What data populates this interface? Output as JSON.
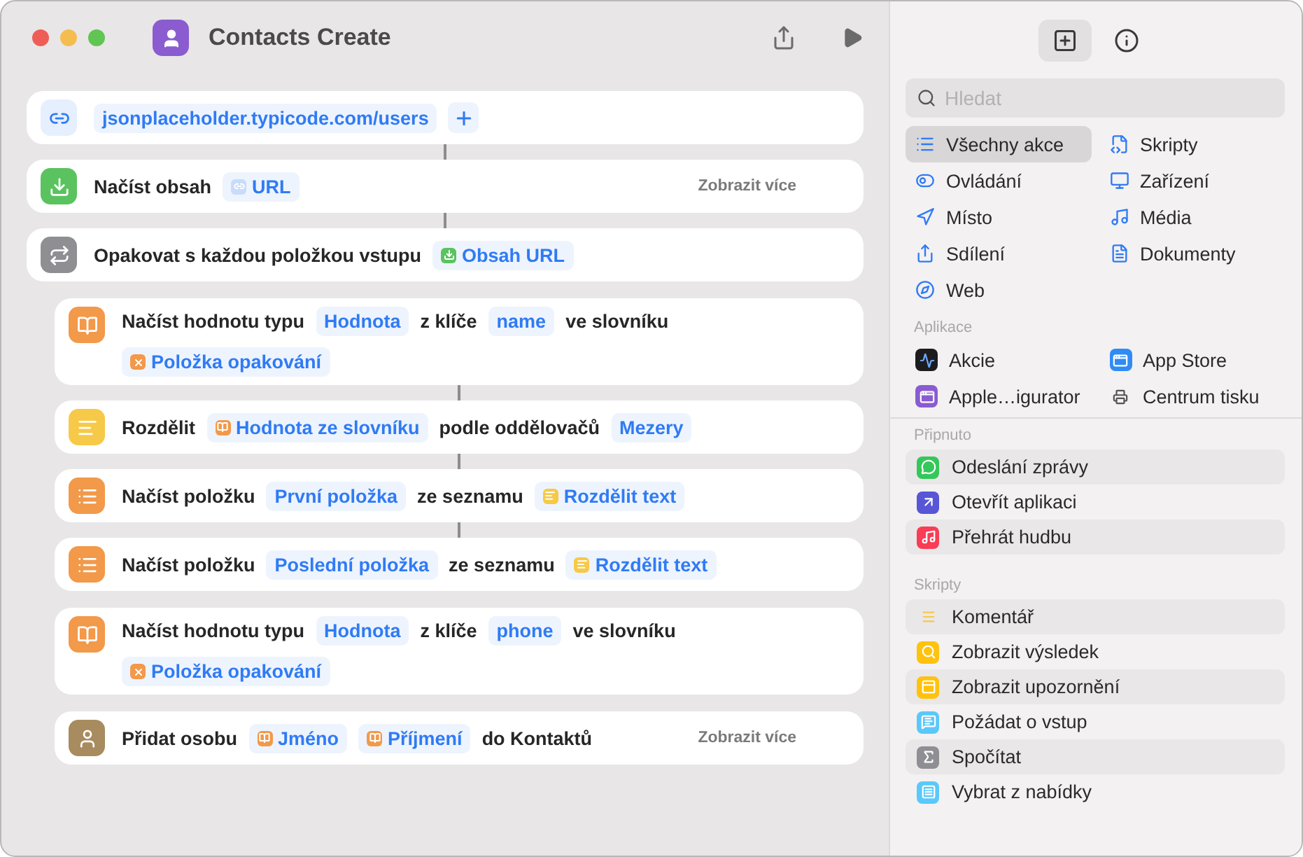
{
  "window": {
    "title": "Contacts Create"
  },
  "actions": [
    {
      "kind": "link",
      "connected_to_next": true,
      "parts": [
        {
          "kind": "token",
          "text": "jsonplaceholder.typicode.com/users"
        },
        {
          "kind": "add"
        }
      ]
    },
    {
      "kind": "download",
      "connected_to_next": true,
      "show_more": "Zobrazit více",
      "parts": [
        {
          "kind": "text",
          "text": "Načíst obsah"
        },
        {
          "kind": "link-token",
          "text": "URL"
        }
      ]
    },
    {
      "kind": "repeat",
      "connected_to_next": false,
      "parts": [
        {
          "kind": "text",
          "text": "Opakovat s každou položkou vstupu"
        },
        {
          "kind": "download-token",
          "text": "Obsah URL"
        }
      ],
      "children": [
        {
          "kind": "dictionary",
          "connected_to_next": true,
          "parts": [
            {
              "kind": "text",
              "text": "Načíst hodnotu typu"
            },
            {
              "kind": "token",
              "text": "Hodnota"
            },
            {
              "kind": "text",
              "text": "z klíče"
            },
            {
              "kind": "token",
              "text": "name"
            },
            {
              "kind": "text",
              "text": "ve slovníku"
            },
            {
              "kind": "break"
            },
            {
              "kind": "variable-token",
              "text": "Položka opakování"
            }
          ]
        },
        {
          "kind": "text",
          "connected_to_next": true,
          "parts": [
            {
              "kind": "text",
              "text": "Rozdělit"
            },
            {
              "kind": "dictionary-token",
              "text": "Hodnota ze slovníku"
            },
            {
              "kind": "text",
              "text": "podle oddělovačů"
            },
            {
              "kind": "token",
              "text": "Mezery"
            }
          ]
        },
        {
          "kind": "list",
          "connected_to_next": true,
          "parts": [
            {
              "kind": "text",
              "text": "Načíst položku"
            },
            {
              "kind": "token",
              "text": "První položka"
            },
            {
              "kind": "text",
              "text": "ze seznamu"
            },
            {
              "kind": "text-token",
              "text": "Rozdělit text"
            }
          ]
        },
        {
          "kind": "list",
          "connected_to_next": false,
          "parts": [
            {
              "kind": "text",
              "text": "Načíst položku"
            },
            {
              "kind": "token",
              "text": "Poslední položka"
            },
            {
              "kind": "text",
              "text": "ze seznamu"
            },
            {
              "kind": "text-token",
              "text": "Rozdělit text"
            }
          ]
        },
        {
          "kind": "dictionary",
          "connected_to_next": false,
          "parts": [
            {
              "kind": "text",
              "text": "Načíst hodnotu typu"
            },
            {
              "kind": "token",
              "text": "Hodnota"
            },
            {
              "kind": "text",
              "text": "z klíče"
            },
            {
              "kind": "token",
              "text": "phone"
            },
            {
              "kind": "text",
              "text": "ve slovníku"
            },
            {
              "kind": "break"
            },
            {
              "kind": "variable-token",
              "text": "Položka opakování"
            }
          ]
        },
        {
          "kind": "contact",
          "connected_to_next": false,
          "show_more": "Zobrazit více",
          "parts": [
            {
              "kind": "text",
              "text": "Přidat osobu"
            },
            {
              "kind": "dictionary-token",
              "text": "Jméno"
            },
            {
              "kind": "dictionary-token",
              "text": "Příjmení"
            },
            {
              "kind": "text",
              "text": "do Kontaktů"
            }
          ]
        }
      ]
    }
  ],
  "library": {
    "tabs": [
      {
        "kind": "add",
        "selected": true
      },
      {
        "kind": "info",
        "selected": false
      }
    ],
    "search": {
      "placeholder": "Hledat"
    },
    "categories": [
      {
        "label": "Všechny akce",
        "kind": "list",
        "selected": true
      },
      {
        "label": "Skripty",
        "kind": "script",
        "selected": false
      },
      {
        "label": "Ovládání",
        "kind": "toggle",
        "selected": false
      },
      {
        "label": "Zařízení",
        "kind": "monitor",
        "selected": false
      },
      {
        "label": "Místo",
        "kind": "location",
        "selected": false
      },
      {
        "label": "Média",
        "kind": "music",
        "selected": false
      },
      {
        "label": "Sdílení",
        "kind": "share",
        "selected": false
      },
      {
        "label": "Dokumenty",
        "kind": "document",
        "selected": false
      },
      {
        "label": "Web",
        "kind": "compass",
        "selected": false
      }
    ],
    "apps_heading": "Aplikace",
    "apps": [
      {
        "label": "Akcie",
        "kind": "stocks"
      },
      {
        "label": "App Store",
        "kind": "appstore"
      },
      {
        "label": "Apple…igurator",
        "kind": "configurator"
      },
      {
        "label": "Centrum tisku",
        "kind": "printer"
      }
    ],
    "sections": [
      {
        "heading": "Připnuto",
        "items": [
          {
            "label": "Odeslání zprávy",
            "kind": "message"
          },
          {
            "label": "Otevřít aplikaci",
            "kind": "open-app"
          },
          {
            "label": "Přehrát hudbu",
            "kind": "music-app"
          }
        ]
      },
      {
        "heading": "Skripty",
        "items": [
          {
            "label": "Komentář",
            "kind": "comment"
          },
          {
            "label": "Zobrazit výsledek",
            "kind": "result"
          },
          {
            "label": "Zobrazit upozornění",
            "kind": "alert"
          },
          {
            "label": "Požádat o vstup",
            "kind": "ask"
          },
          {
            "label": "Spočítat",
            "kind": "sigma"
          },
          {
            "label": "Vybrat z nabídky",
            "kind": "menu-pick"
          }
        ]
      }
    ]
  }
}
